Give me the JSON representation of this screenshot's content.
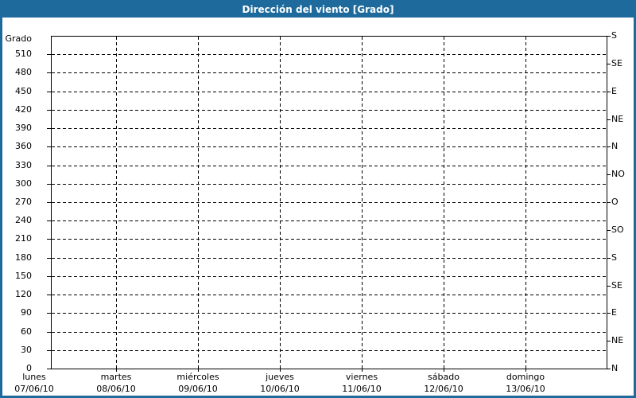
{
  "window": {
    "title": "Dirección del viento [Grado]"
  },
  "colors": {
    "titlebar_bg": "#1e6a9d",
    "titlebar_text": "#ffffff",
    "frame_border": "#1e6a9d",
    "plot_background": "#ffffff",
    "grid_color": "#000000",
    "label_color": "#000000"
  },
  "chart_data": {
    "type": "line",
    "title": "Dirección del viento [Grado]",
    "grid": "dashed-both-directions",
    "legend": "none",
    "series": [],
    "left_axis": {
      "label": "Grado",
      "ylim": [
        0,
        540
      ],
      "ticks": [
        0,
        30,
        60,
        90,
        120,
        150,
        180,
        210,
        240,
        270,
        300,
        330,
        360,
        390,
        420,
        450,
        480,
        510
      ]
    },
    "right_axis": {
      "tick_step_degrees": 45,
      "labels_bottom_to_top": [
        "N",
        "NE",
        "E",
        "SE",
        "S",
        "SO",
        "O",
        "NO",
        "N",
        "NE",
        "E",
        "SE",
        "S"
      ]
    },
    "x_axis": {
      "days": [
        {
          "name": "lunes",
          "date": "07/06/10"
        },
        {
          "name": "martes",
          "date": "08/06/10"
        },
        {
          "name": "miércoles",
          "date": "09/06/10"
        },
        {
          "name": "jueves",
          "date": "10/06/10"
        },
        {
          "name": "viernes",
          "date": "11/06/10"
        },
        {
          "name": "sábado",
          "date": "12/06/10"
        },
        {
          "name": "domingo",
          "date": "13/06/10"
        }
      ]
    }
  }
}
